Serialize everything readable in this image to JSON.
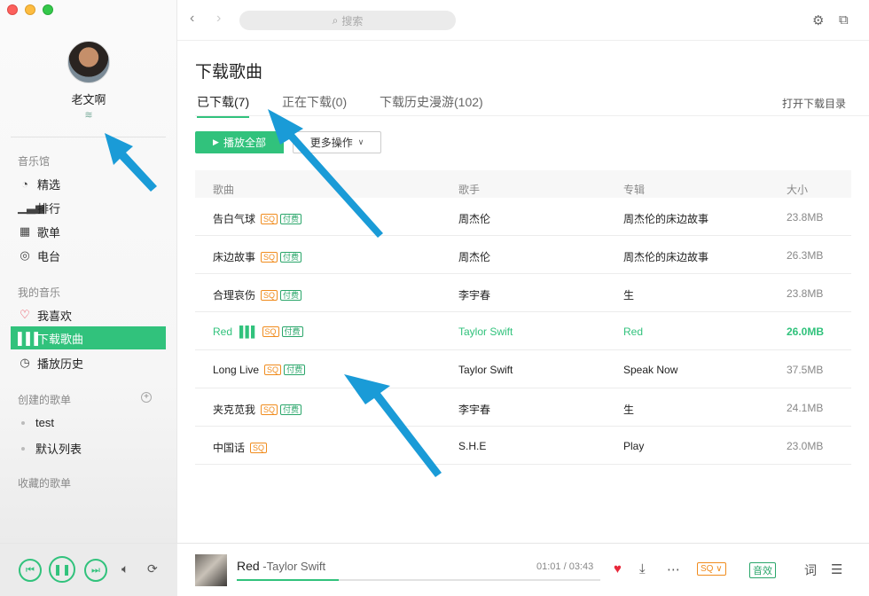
{
  "sidebar": {
    "username": "老文啊",
    "sections": {
      "music_hall": "音乐馆",
      "my_music": "我的音乐",
      "created_playlists": "创建的歌单",
      "collected_playlists": "收藏的歌单"
    },
    "music_hall_items": [
      {
        "label": "精选",
        "icon": "featured-icon"
      },
      {
        "label": "排行",
        "icon": "chart-icon"
      },
      {
        "label": "歌单",
        "icon": "grid-icon"
      },
      {
        "label": "电台",
        "icon": "radio-icon"
      }
    ],
    "my_music_items": [
      {
        "label": "我喜欢",
        "icon": "heart-icon"
      },
      {
        "label": "下载歌曲",
        "icon": "download-bars-icon",
        "active": true
      },
      {
        "label": "播放历史",
        "icon": "clock-icon"
      }
    ],
    "playlists": [
      "test",
      "默认列表"
    ]
  },
  "topbar": {
    "search_placeholder": "搜索"
  },
  "main": {
    "title": "下载歌曲",
    "tabs": [
      {
        "label": "已下载(7)",
        "active": true
      },
      {
        "label": "正在下载(0)"
      },
      {
        "label": "下载历史漫游(102)"
      }
    ],
    "open_dir": "打开下载目录",
    "play_all": "播放全部",
    "more_actions": "更多操作"
  },
  "table": {
    "headers": [
      "歌曲",
      "歌手",
      "专辑",
      "大小"
    ],
    "tag_sq": "SQ",
    "tag_pay": "付费",
    "rows": [
      {
        "title": "告白气球",
        "artist": "周杰伦",
        "album": "周杰伦的床边故事",
        "size": "23.8MB",
        "sq": true,
        "paid": true
      },
      {
        "title": "床边故事",
        "artist": "周杰伦",
        "album": "周杰伦的床边故事",
        "size": "26.3MB",
        "sq": true,
        "paid": true
      },
      {
        "title": "合理哀伤",
        "artist": "李宇春",
        "album": "生",
        "size": "23.8MB",
        "sq": true,
        "paid": true
      },
      {
        "title": "Red",
        "artist": "Taylor Swift",
        "album": "Red",
        "size": "26.0MB",
        "sq": true,
        "paid": true,
        "playing": true
      },
      {
        "title": "Long Live",
        "artist": "Taylor Swift",
        "album": "Speak Now",
        "size": "37.5MB",
        "sq": true,
        "paid": true
      },
      {
        "title": "夹克苋我",
        "artist": "李宇春",
        "album": "生",
        "size": "24.1MB",
        "sq": true,
        "paid": true
      },
      {
        "title": "中国话",
        "artist": "S.H.E",
        "album": "Play",
        "size": "23.0MB",
        "sq": true,
        "paid": false
      }
    ]
  },
  "player": {
    "title": "Red",
    "artist": " -Taylor Swift",
    "time": "01:01 / 03:43",
    "progress": 0.28,
    "quality": "SQ",
    "effect": "音效",
    "lyrics": "词"
  },
  "colors": {
    "accent": "#31c27c",
    "sq": "#f08c1e",
    "heart": "#e8283b",
    "annotation_arrow": "#1a9bd7"
  }
}
